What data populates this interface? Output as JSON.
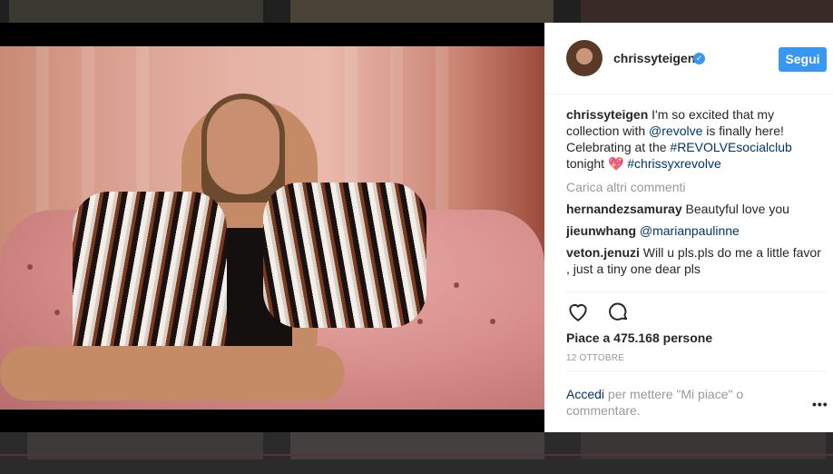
{
  "post": {
    "username": "chrissyteigen",
    "follow_label": "Segui",
    "caption": {
      "user": "chrissyteigen",
      "text_1": " I'm so excited that my collection with ",
      "mention": "@revolve",
      "text_2": " is finally here! Celebrating at the ",
      "hashtag_1": "#REVOLVEsocialclub",
      "text_3": " tonight ",
      "emoji": "💖",
      "hashtag_2": "#chrissyxrevolve"
    },
    "load_more": "Carica altri commenti",
    "comments": [
      {
        "user": "hernandezsamuray",
        "text": " Beautyful love you"
      },
      {
        "user": "jieunwhang",
        "mention": " @marianpaulinne"
      },
      {
        "user": "veton.jenuzi",
        "text": " Will u pls.pls do me a little favor , just a tiny one dear pls"
      }
    ],
    "likes": "Piace a 475.168 persone",
    "date": "12 OTTOBRE",
    "login_link": "Accedi",
    "login_text": " per mettere \"Mi piace\" o commentare.",
    "more_options": "•••"
  },
  "icons": [
    "heart-icon",
    "comment-icon",
    "verified-icon"
  ],
  "colors": {
    "accent": "#3897f0",
    "link": "#003569",
    "muted": "#999999"
  }
}
